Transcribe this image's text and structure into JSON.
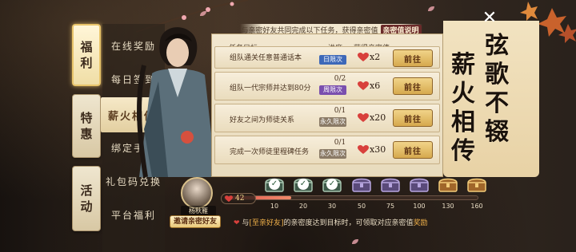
{
  "tabs": [
    {
      "name": "welfare",
      "label_chars": [
        "福",
        "利"
      ],
      "active": true
    },
    {
      "name": "discount",
      "label_chars": [
        "特",
        "惠"
      ],
      "active": false
    },
    {
      "name": "activity",
      "label_chars": [
        "活",
        "动"
      ],
      "active": false
    }
  ],
  "side_menu": [
    {
      "key": "online",
      "label": "在线奖励",
      "active": false
    },
    {
      "key": "daily",
      "label": "每日签到",
      "active": false
    },
    {
      "key": "fire",
      "label": "薪火相传",
      "active": true
    },
    {
      "key": "phone",
      "label": "绑定手机",
      "active": false
    },
    {
      "key": "gift",
      "label": "礼包码兑换",
      "active": false
    },
    {
      "key": "platform",
      "label": "平台福利",
      "active": false
    }
  ],
  "notice": {
    "text": "与亲密好友共同完成以下任务，获得亲密值",
    "rule_link": "亲密值说明"
  },
  "table_headers": {
    "task": "任务目标",
    "progress": "进度",
    "reward": "获得亲密值"
  },
  "tasks": [
    {
      "name": "组队通关任意普通话本",
      "progress": "",
      "tag": "日限次",
      "tag_color": "#3d68b8",
      "reward": "x2",
      "button": "前往"
    },
    {
      "name": "组队一代宗师并达到80分",
      "progress": "0/2",
      "tag": "周限次",
      "tag_color": "#7a4fae",
      "reward": "x6",
      "button": "前往"
    },
    {
      "name": "好友之间为师徒关系",
      "progress": "0/1",
      "tag": "永久限次",
      "tag_color": "#8a7a66",
      "reward": "x20",
      "button": "前往"
    },
    {
      "name": "完成一次师徒里程碑任务",
      "progress": "0/1",
      "tag": "永久限次",
      "tag_color": "#8a7a66",
      "reward": "x30",
      "button": "前往"
    }
  ],
  "title_columns": [
    [
      "弦",
      "歌",
      "不",
      "辍"
    ],
    [
      "薪",
      "火",
      "相",
      "传"
    ]
  ],
  "close_icon": "close-icon",
  "friend": {
    "name": "杨秋雁",
    "invite_button": "邀请亲密好友"
  },
  "intimacy": {
    "current": "42",
    "max": 160
  },
  "milestones": [
    {
      "value": "10",
      "state": "claimed"
    },
    {
      "value": "20",
      "state": "claimed"
    },
    {
      "value": "30",
      "state": "claimed"
    },
    {
      "value": "50",
      "state": "locked"
    },
    {
      "value": "75",
      "state": "locked"
    },
    {
      "value": "100",
      "state": "locked"
    },
    {
      "value": "130",
      "state": "locked-gold"
    },
    {
      "value": "160",
      "state": "locked-gold"
    }
  ],
  "footer": {
    "prefix": "与",
    "highlight": "[至亲好友]",
    "middle": "的亲密度达到目标时，可领取对应亲密值",
    "suffix": "奖励"
  },
  "colors": {
    "accent": "#e8c46a",
    "heart": "#d8403c",
    "button": "#d6a94d"
  }
}
